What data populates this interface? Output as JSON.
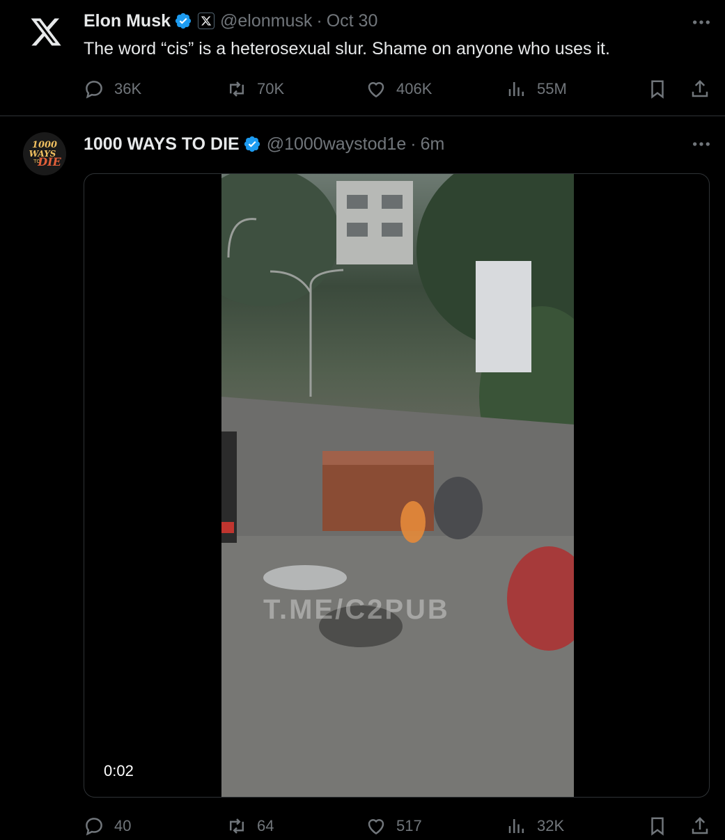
{
  "colors": {
    "background": "#000000",
    "text_primary": "#e7e9ea",
    "text_secondary": "#71767b",
    "verified_blue": "#1d9bf0",
    "divider": "#2f3336"
  },
  "tweets": [
    {
      "avatar_icon": "x-logo-icon",
      "name": "Elon Musk",
      "verified": true,
      "affiliation_icon": "x-affiliate-badge-icon",
      "handle": "@elonmusk",
      "dot": "·",
      "time": "Oct 30",
      "text": "The word “cis” is a heterosexual slur. Shame on anyone who uses it.",
      "stats": {
        "replies": "36K",
        "reposts": "70K",
        "likes": "406K",
        "views": "55M"
      }
    },
    {
      "avatar_icon": "1000-ways-to-die-logo",
      "avatar_text": "1000 WAYS TO DIE",
      "name": "1000 WAYS TO DIE",
      "verified": true,
      "handle": "@1000waystod1e",
      "dot": "·",
      "time": "6m",
      "media": {
        "type": "video",
        "duration": "0:02",
        "watermark": "T.ME/C2PUB"
      },
      "stats": {
        "replies": "40",
        "reposts": "64",
        "likes": "517",
        "views": "32K"
      }
    }
  ]
}
